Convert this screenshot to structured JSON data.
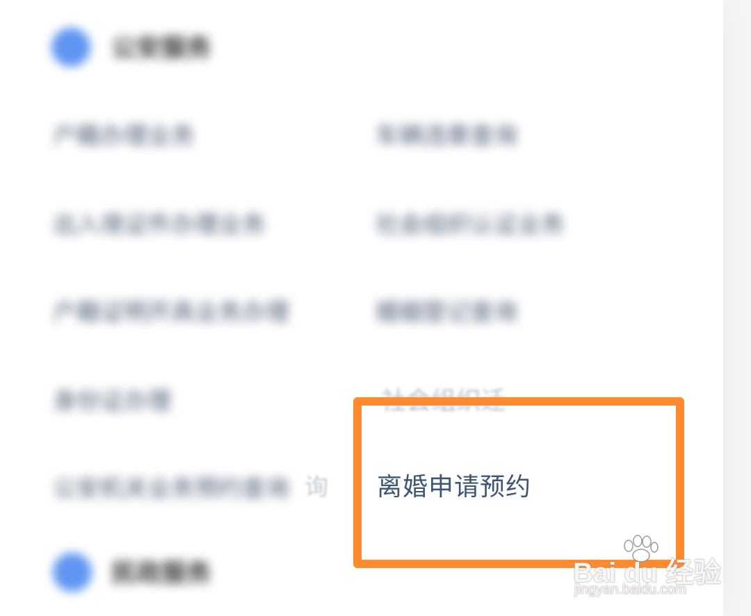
{
  "sections": [
    {
      "title": "公安服务",
      "items_left": [
        "户籍办理业务",
        "出入境证件办理业务",
        "户籍证明开具业务办理",
        "身份证办理",
        "公安机关业务预约查询"
      ],
      "items_right": [
        "车辆违章查询",
        "社会组织认证业务",
        "婚姻登记查询"
      ],
      "partial_item": "社会组织迁",
      "partial_tail": "询",
      "focus_item": "离婚申请预约"
    },
    {
      "title": "民政服务"
    }
  ],
  "watermark": {
    "brand": "Bai du 经验",
    "url": "jingyan.baidu.com"
  },
  "colors": {
    "highlight": "#ff8a30",
    "accent_icon": "#5e95f2",
    "focus_text": "#3e5577"
  }
}
